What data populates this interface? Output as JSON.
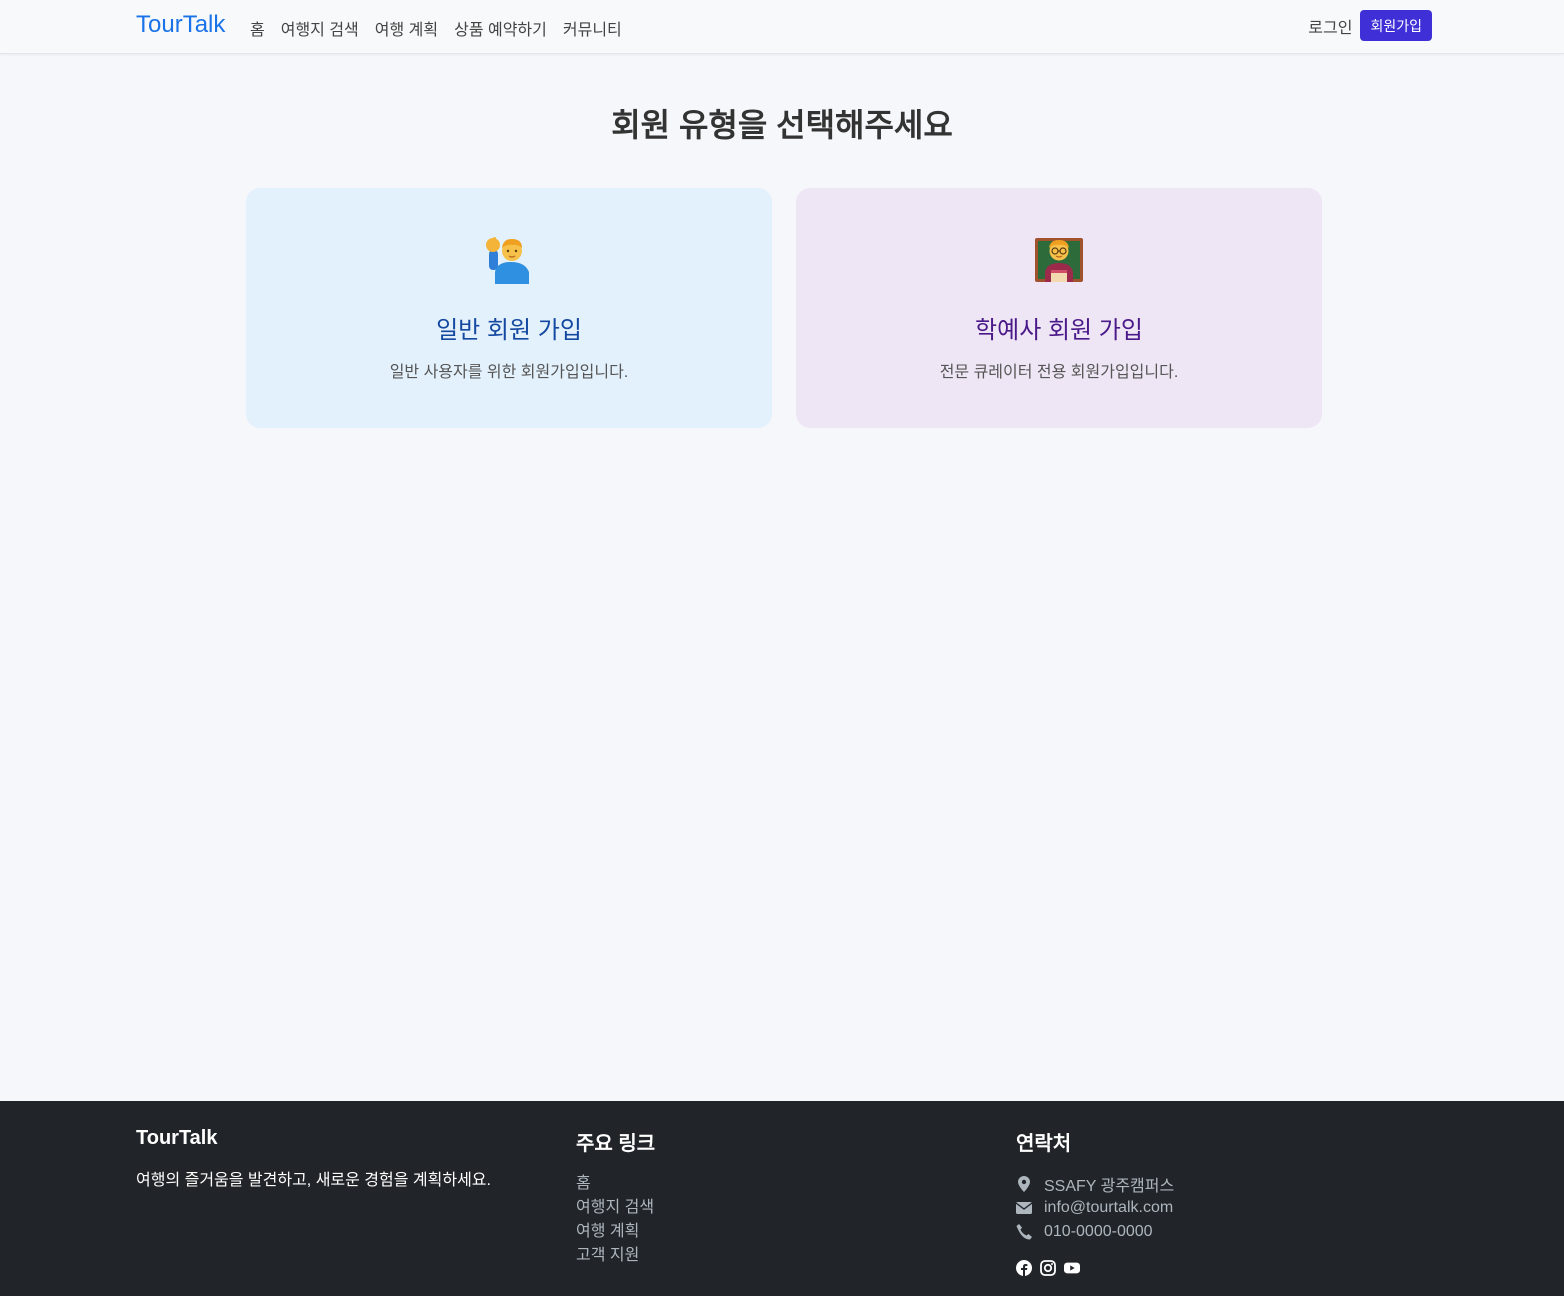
{
  "navbar": {
    "brand": "TourTalk",
    "links": [
      "홈",
      "여행지 검색",
      "여행 계획",
      "상품 예약하기",
      "커뮤니티"
    ],
    "login": "로그인",
    "signup": "회원가입"
  },
  "main": {
    "title": "회원 유형을 선택해주세요",
    "cards": [
      {
        "icon": "person-raising-hand-icon",
        "title": "일반 회원 가입",
        "description": "일반 사용자를 위한 회원가입입니다."
      },
      {
        "icon": "teacher-icon",
        "title": "학예사 회원 가입",
        "description": "전문 큐레이터 전용 회원가입입니다."
      }
    ]
  },
  "footer": {
    "brand": "TourTalk",
    "tagline": "여행의 즐거움을 발견하고, 새로운 경험을 계획하세요.",
    "links_title": "주요 링크",
    "links": [
      "홈",
      "여행지 검색",
      "여행 계획",
      "고객 지원"
    ],
    "contact_title": "연락처",
    "address": "SSAFY 광주캠퍼스",
    "email": "info@tourtalk.com",
    "phone": "010-0000-0000",
    "social_icons": [
      "facebook-icon",
      "instagram-icon",
      "youtube-icon"
    ]
  },
  "colors": {
    "brand": "#1a73e8",
    "signup_button": "#3f2fd6",
    "general_card": "#e3f1fc",
    "curator_card": "#efe6f5",
    "footer_bg": "#212529"
  }
}
